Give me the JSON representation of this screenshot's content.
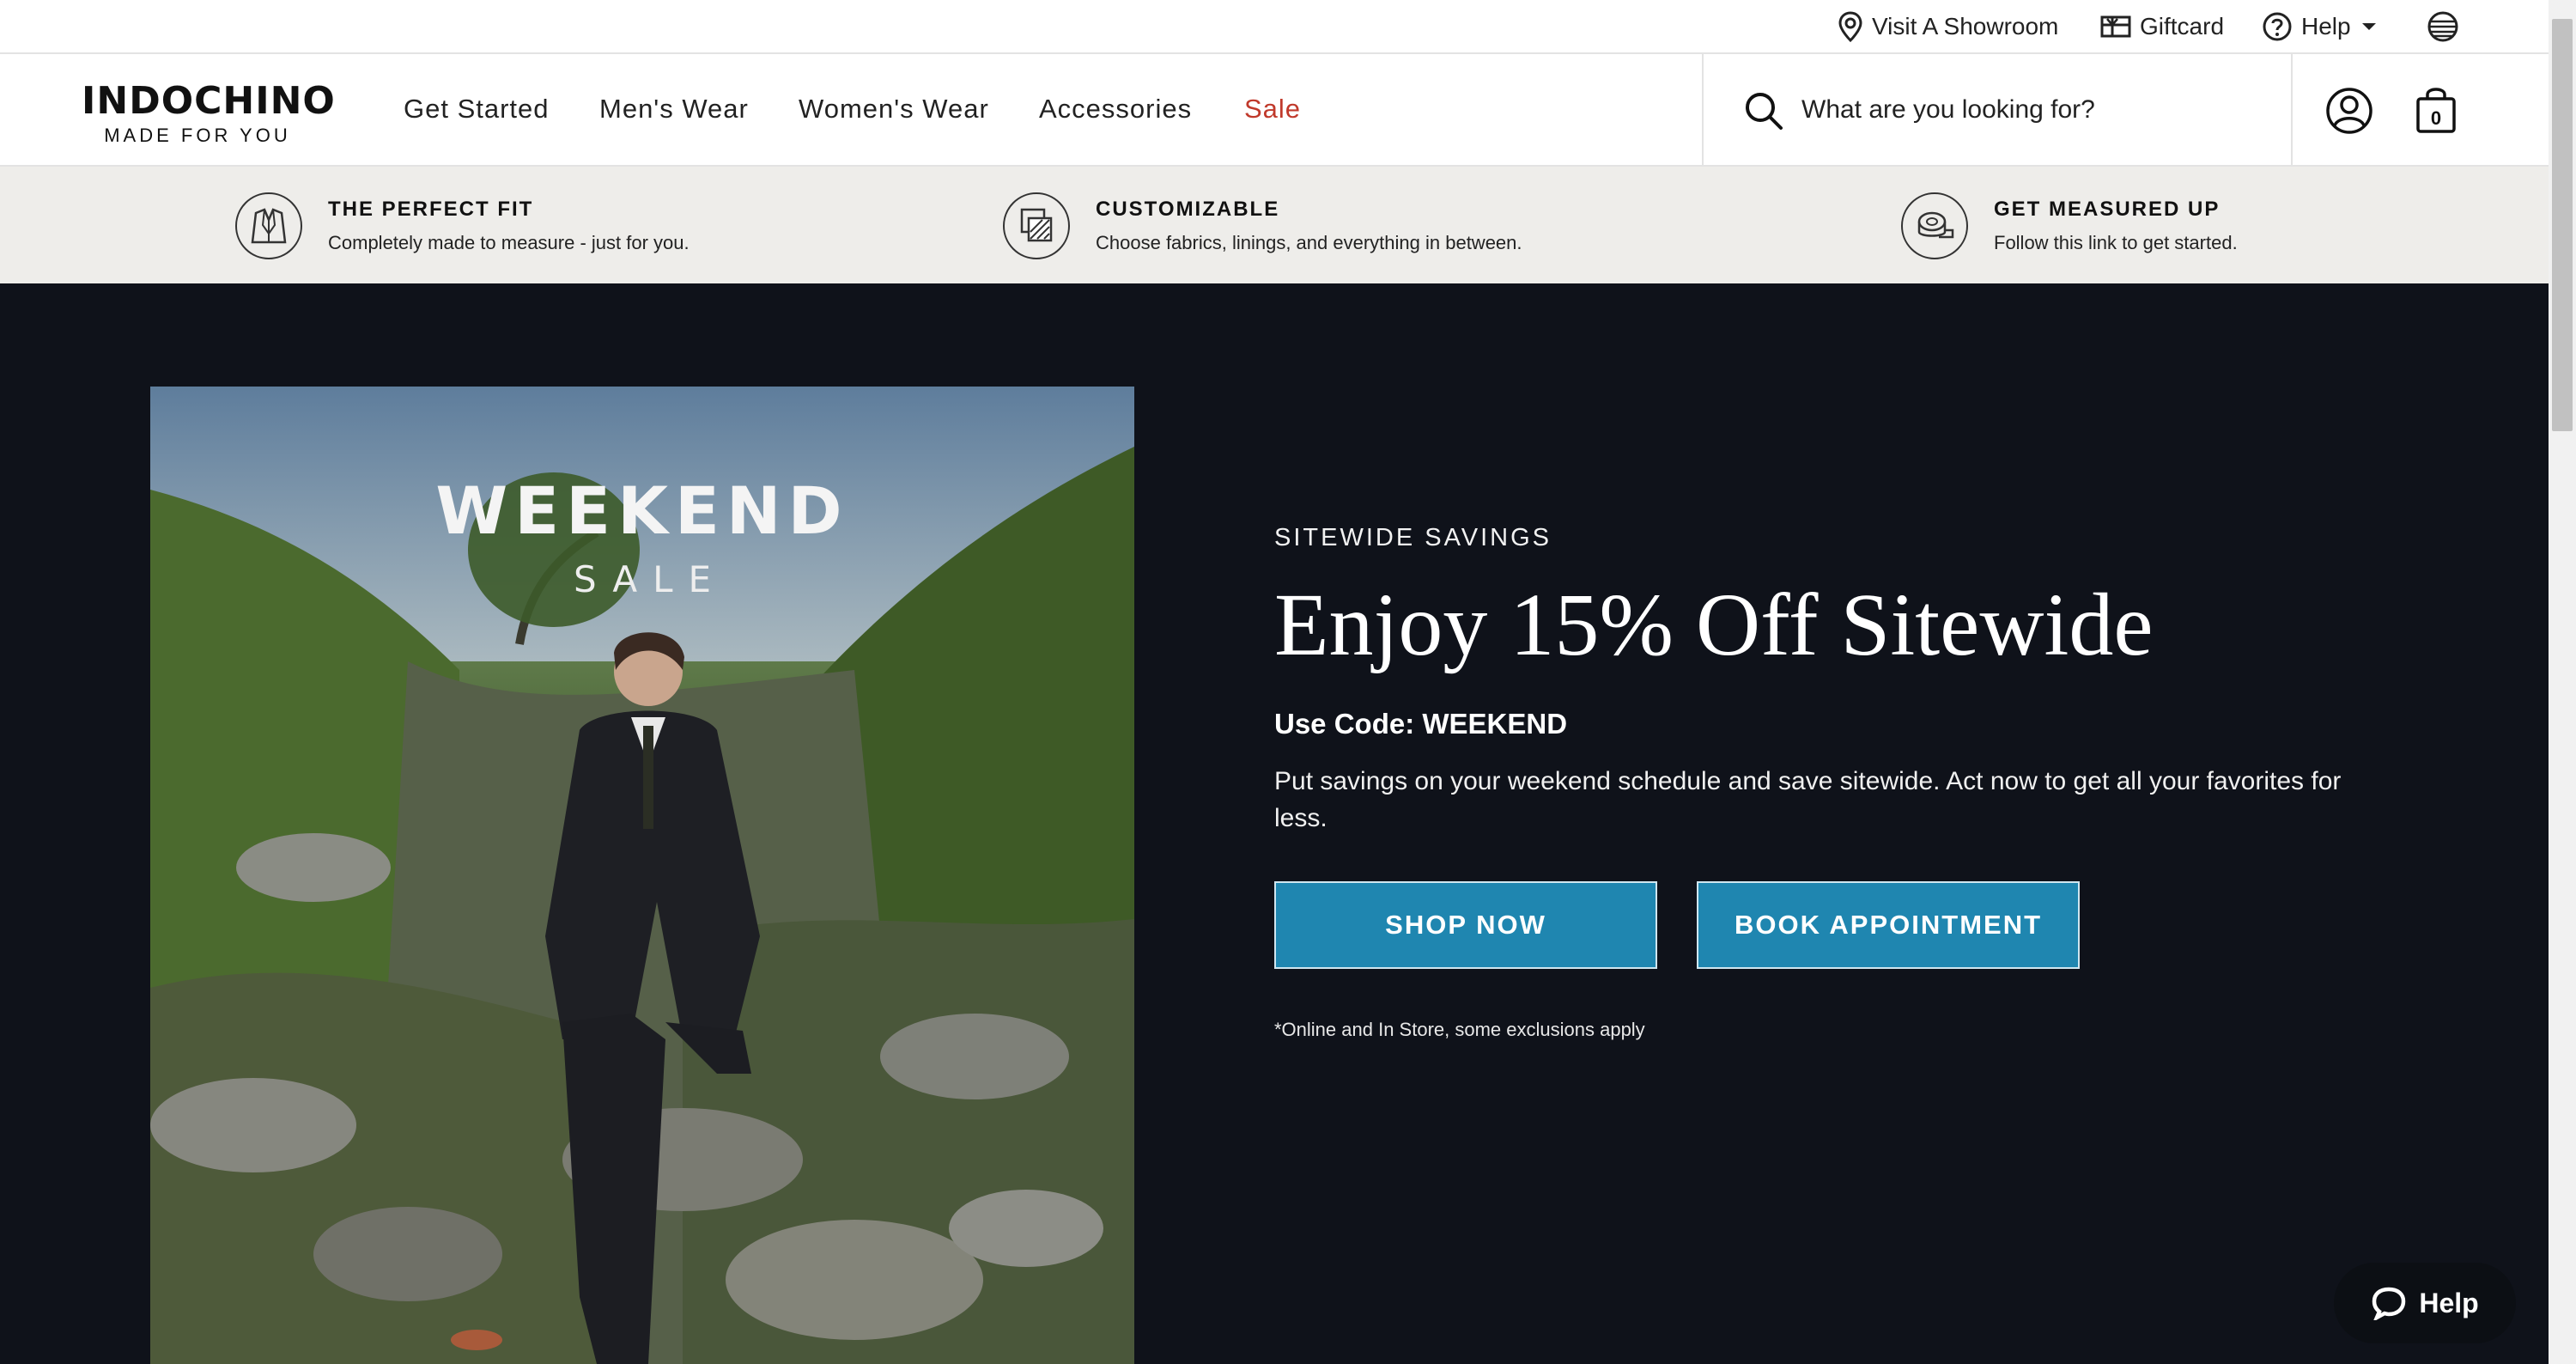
{
  "utility": {
    "showroom": "Visit A Showroom",
    "giftcard": "Giftcard",
    "help": "Help",
    "globe_icon": "globe-icon"
  },
  "header": {
    "logo": "INDOCHINO",
    "tagline": "MADE FOR YOU",
    "nav": [
      "Get Started",
      "Men's Wear",
      "Women's Wear",
      "Accessories",
      "Sale"
    ],
    "search_placeholder": "What are you looking for?",
    "cart_count": "0",
    "sale_color": "#c0392b"
  },
  "value_props": [
    {
      "title": "THE PERFECT FIT",
      "desc": "Completely made to measure - just for you.",
      "icon": "suit-jacket-icon"
    },
    {
      "title": "CUSTOMIZABLE",
      "desc": "Choose fabrics, linings, and everything in between.",
      "icon": "fabric-swatch-icon"
    },
    {
      "title": "GET MEASURED UP",
      "desc": "Follow this link to get started.",
      "icon": "tape-measure-icon"
    }
  ],
  "hero": {
    "image_title": "WEEKEND",
    "image_subtitle": "SALE",
    "eyebrow": "SITEWIDE SAVINGS",
    "headline": "Enjoy 15% Off Sitewide",
    "code": "Use Code: WEEKEND",
    "body": "Put savings on your weekend schedule and save sitewide. Act now to get all your favorites for less.",
    "primary_button": "SHOP NOW",
    "secondary_button": "BOOK APPOINTMENT",
    "disclaimer": "*Online and In Store, some exclusions apply",
    "button_color": "#1f86b0",
    "background": "#0f121a"
  },
  "chat": {
    "label": "Help"
  }
}
